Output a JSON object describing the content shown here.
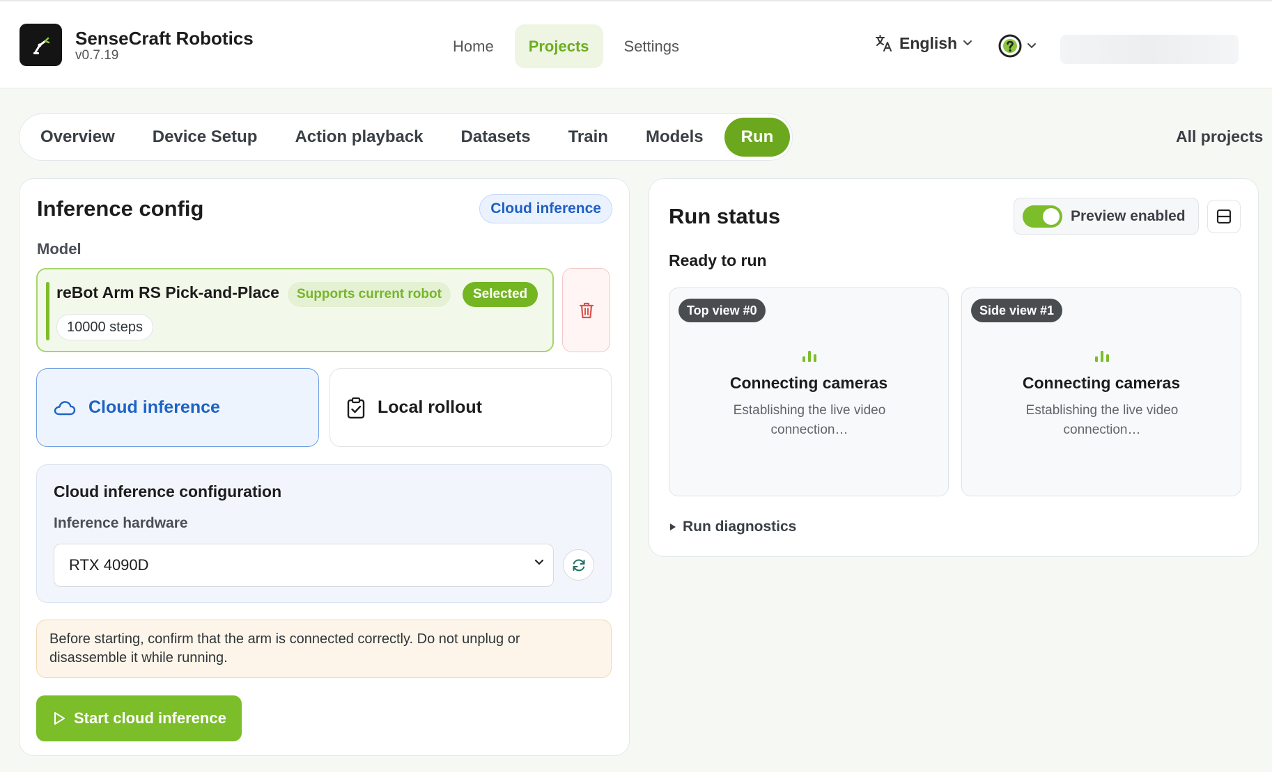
{
  "app": {
    "title": "SenseCraft Robotics",
    "version": "v0.7.19"
  },
  "nav": [
    {
      "label": "Home"
    },
    {
      "label": "Projects",
      "active": true
    },
    {
      "label": "Settings"
    }
  ],
  "language": {
    "icon": "translate-icon",
    "label": "English"
  },
  "help": {
    "icon": "help-circle-icon"
  },
  "tabs": [
    {
      "label": "Overview"
    },
    {
      "label": "Device Setup"
    },
    {
      "label": "Action playback"
    },
    {
      "label": "Datasets"
    },
    {
      "label": "Train"
    },
    {
      "label": "Models"
    },
    {
      "label": "Run",
      "active": true
    }
  ],
  "all_projects": "All projects",
  "inference": {
    "title": "Inference config",
    "mode_badge": "Cloud inference",
    "model_label": "Model",
    "model": {
      "name": "reBot Arm RS Pick-and-Place",
      "support_badge": "Supports current robot",
      "selected_badge": "Selected",
      "steps": "10000 steps"
    },
    "modes": [
      {
        "label": "Cloud inference",
        "icon": "cloud-icon",
        "selected": true
      },
      {
        "label": "Local rollout",
        "icon": "clipboard-check-icon",
        "selected": false
      }
    ],
    "config": {
      "title": "Cloud inference configuration",
      "hardware_label": "Inference hardware",
      "hardware_value": "RTX 4090D"
    },
    "warning": "Before starting, confirm that the arm is connected correctly. Do not unplug or disassemble it while running.",
    "start_label": "Start cloud inference"
  },
  "run": {
    "title": "Run status",
    "preview_label": "Preview enabled",
    "preview_on": true,
    "status": "Ready to run",
    "cameras": [
      {
        "badge": "Top view #0",
        "title": "Connecting cameras",
        "subtitle": "Establishing the live video connection…"
      },
      {
        "badge": "Side view #1",
        "title": "Connecting cameras",
        "subtitle": "Establishing the live video connection…"
      }
    ],
    "diagnostics": "Run diagnostics"
  },
  "colors": {
    "accent": "#7cbd2a",
    "cloud_blue": "#1d63c6",
    "danger": "#d9534f"
  }
}
